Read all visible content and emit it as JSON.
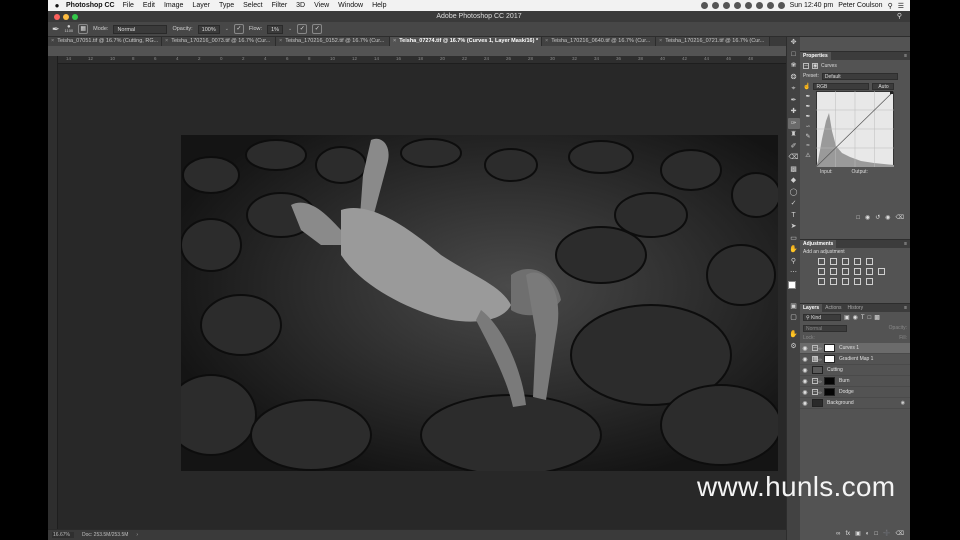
{
  "menubar": {
    "app_name": "Photoshop CC",
    "menus": [
      "File",
      "Edit",
      "Image",
      "Layer",
      "Type",
      "Select",
      "Filter",
      "3D",
      "View",
      "Window",
      "Help"
    ],
    "clock": "Sun 12:40 pm",
    "user": "Peter Coulson"
  },
  "window": {
    "title": "Adobe Photoshop CC 2017"
  },
  "options_bar": {
    "mode_label": "Mode:",
    "mode_value": "Normal",
    "opacity_label": "Opacity:",
    "opacity_value": "100%",
    "flow_label": "Flow:",
    "flow_value": "1%",
    "brush_size": "1100"
  },
  "tabs": [
    {
      "label": "Teisha_07051.tif @ 16.7% (Cutting, RG...",
      "active": false
    },
    {
      "label": "Teisha_170216_0073.tif @ 16.7% (Cur...",
      "active": false
    },
    {
      "label": "Teisha_170216_0152.tif @ 16.7% (Cur...",
      "active": false
    },
    {
      "label": "Teisha_07274.tif @ 16.7% (Curves 1, Layer Mask/16) *",
      "active": true
    },
    {
      "label": "Teisha_170216_0640.tif @ 16.7% (Cur...",
      "active": false
    },
    {
      "label": "Teisha_170216_0721.tif @ 16.7% (Cur...",
      "active": false
    }
  ],
  "tabs_more": "»",
  "ruler_ticks": [
    "14",
    "12",
    "10",
    "8",
    "6",
    "4",
    "2",
    "0",
    "2",
    "4",
    "6",
    "8",
    "10",
    "12",
    "14",
    "16",
    "18",
    "20",
    "22",
    "24",
    "26",
    "28",
    "30",
    "32",
    "34",
    "36",
    "38",
    "40",
    "42",
    "44",
    "46",
    "48"
  ],
  "status": {
    "zoom": "16.67%",
    "doc": "Doc: 253.5M/253.5M"
  },
  "properties": {
    "tab": "Properties",
    "title": "Curves",
    "preset_label": "Preset:",
    "preset_value": "Default",
    "channel": "RGB",
    "auto": "Auto",
    "input_label": "Input:",
    "output_label": "Output:"
  },
  "adjustments": {
    "tab": "Adjustments",
    "subtitle": "Add an adjustment"
  },
  "layers_panel": {
    "tabs": [
      "Layers",
      "Actions",
      "History"
    ],
    "filter": "Kind",
    "blend": "Normal",
    "opacity_label": "Opacity:",
    "lock_label": "Lock:",
    "fill_label": "Fill:",
    "layers": [
      {
        "name": "Curves 1",
        "selected": true,
        "thumb_color": "#ffffff",
        "has_mask": true
      },
      {
        "name": "Gradient Map 1",
        "selected": false,
        "thumb_color": "#ffffff",
        "has_mask": true
      },
      {
        "name": "Cutting",
        "selected": false,
        "thumb_color": "#5a5a5a",
        "has_mask": false
      },
      {
        "name": "Burn",
        "selected": false,
        "thumb_color": "#050505",
        "has_mask": true
      },
      {
        "name": "Dodge",
        "selected": false,
        "thumb_color": "#050505",
        "has_mask": true
      },
      {
        "name": "Background",
        "selected": false,
        "thumb_color": "#2a2a2a",
        "has_mask": false
      }
    ]
  },
  "watermark": "www.hunls.com",
  "colors": {
    "panel_bg": "#535353",
    "canvas_bg": "#282828",
    "selected_layer": "#6b6b6b"
  }
}
